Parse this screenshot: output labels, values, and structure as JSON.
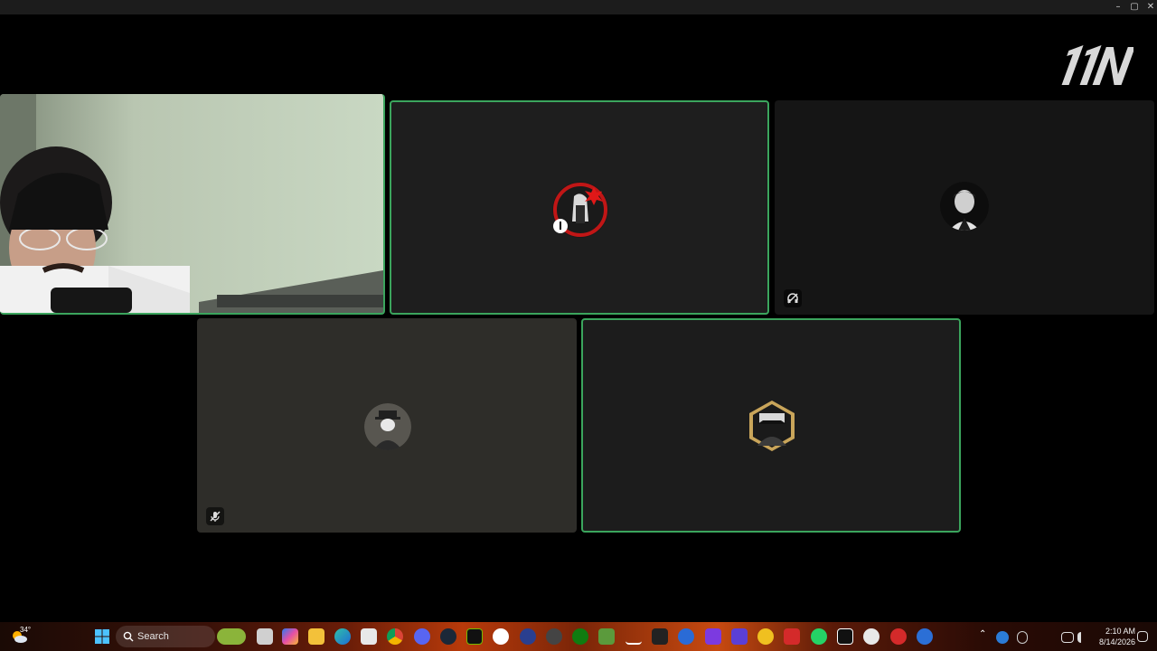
{
  "window": {
    "controls": [
      "–",
      "▢",
      "✕"
    ]
  },
  "brand": {
    "logo_text": "11N"
  },
  "tiles": [
    {
      "name": "participant-webcam",
      "speaking": false,
      "type": "video"
    },
    {
      "name": "participant-2",
      "speaking": true,
      "type": "avatar",
      "muted": false
    },
    {
      "name": "participant-3",
      "speaking": false,
      "type": "avatar",
      "muted": true
    },
    {
      "name": "participant-4",
      "speaking": false,
      "type": "avatar",
      "muted": true
    },
    {
      "name": "participant-5",
      "speaking": true,
      "type": "avatar",
      "muted": false
    }
  ],
  "taskbar": {
    "weather": "34°",
    "search_placeholder": "Search",
    "time": "2:10 AM",
    "date": "8/14/2026",
    "icons": [
      "start-icon",
      "widgets-icon",
      "task-view-icon",
      "copilot-icon",
      "file-explorer-icon",
      "edge-icon",
      "store-icon",
      "chrome-icon",
      "discord-icon",
      "steam-icon",
      "nvidia-icon",
      "obs-icon",
      "ea-icon",
      "nvidia-app-icon",
      "xbox-icon",
      "minecraft-icon",
      "pen-icon",
      "capcut-icon",
      "app-icon",
      "twitch-icon",
      "purple-app-icon",
      "yellow-app-icon",
      "red-app-icon",
      "whatsapp-icon",
      "capcut-icon-2",
      "settings-icon",
      "gear-app-icon",
      "steelseries-icon"
    ],
    "accent_color": "#3ba55d"
  }
}
